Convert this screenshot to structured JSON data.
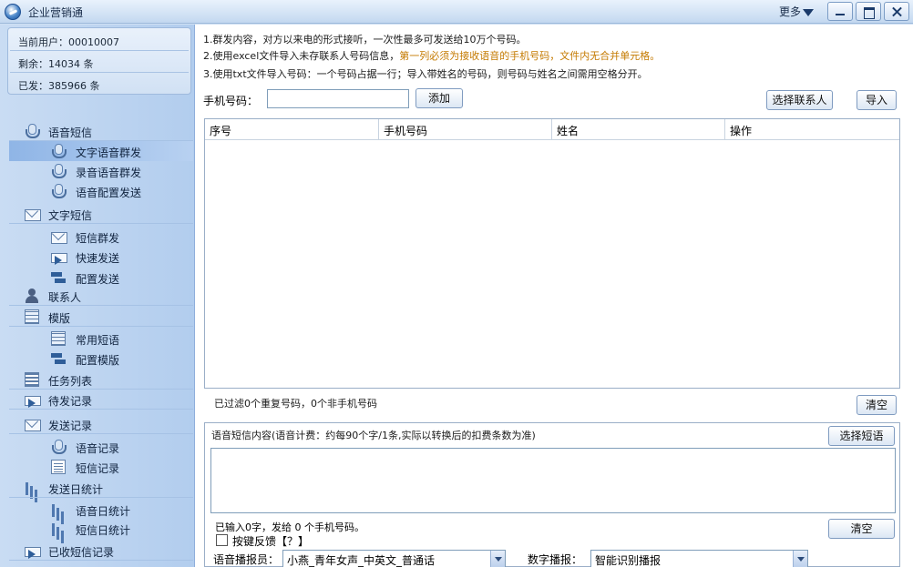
{
  "window": {
    "title": "企业营销通",
    "more_label": "更多"
  },
  "account": {
    "current_user": "当前用户：00010007",
    "remaining": "剩余：14034 条",
    "sent": "已发：385966 条"
  },
  "sidebar": {
    "voice_sms": "语音短信",
    "text_voice_broadcast": "文字语音群发",
    "recorded_voice_broadcast": "录音语音群发",
    "voice_config_send": "语音配置发送",
    "text_sms": "文字短信",
    "sms_broadcast": "短信群发",
    "quick_send": "快速发送",
    "config_send": "配置发送",
    "contacts": "联系人",
    "templates": "模版",
    "common_phrases": "常用短语",
    "config_templates": "配置模版",
    "task_list": "任务列表",
    "pending_records": "待发记录",
    "send_records": "发送记录",
    "voice_records": "语音记录",
    "sms_records": "短信记录",
    "daily_stats": "发送日统计",
    "voice_daily_stats": "语音日统计",
    "sms_daily_stats": "短信日统计",
    "received_sms": "已收短信记录"
  },
  "instructions": {
    "line1": "1.群发内容，对方以来电的形式接听，一次性最多可发送给10万个号码。",
    "line2_prefix": "2.使用excel文件导入未存联系人号码信息，",
    "line2_warning": "第一列必须为接收语音的手机号码，文件内无合并单元格。",
    "line3": "3.使用txt文件导入号码：一个号码占据一行；导入带姓名的号码，则号码与姓名之间需用空格分开。"
  },
  "phone_entry": {
    "label": "手机号码：",
    "value": "",
    "add_button": "添加",
    "select_contacts_button": "选择联系人",
    "import_button": "导入"
  },
  "table": {
    "columns": [
      "序号",
      "手机号码",
      "姓名",
      "操作"
    ],
    "rows": []
  },
  "filter_status": "已过滤0个重复号码，0个非手机号码",
  "clear_button": "清空",
  "message": {
    "label": "语音短信内容(语音计费：约每90个字/1条,实际以转换后的扣费条数为准)",
    "select_phrase_button": "选择短语",
    "content": "",
    "count_text": "已输入0字，发给 0 个手机号码。",
    "clear_button": "清空",
    "keypress_feedback_label": "按键反馈【？】",
    "keypress_feedback_checked": false,
    "voice_label": "语音播报员：",
    "voice_value": "小燕_青年女声_中英文_普通话",
    "digit_label": "数字播报：",
    "digit_value": "智能识别播报"
  }
}
